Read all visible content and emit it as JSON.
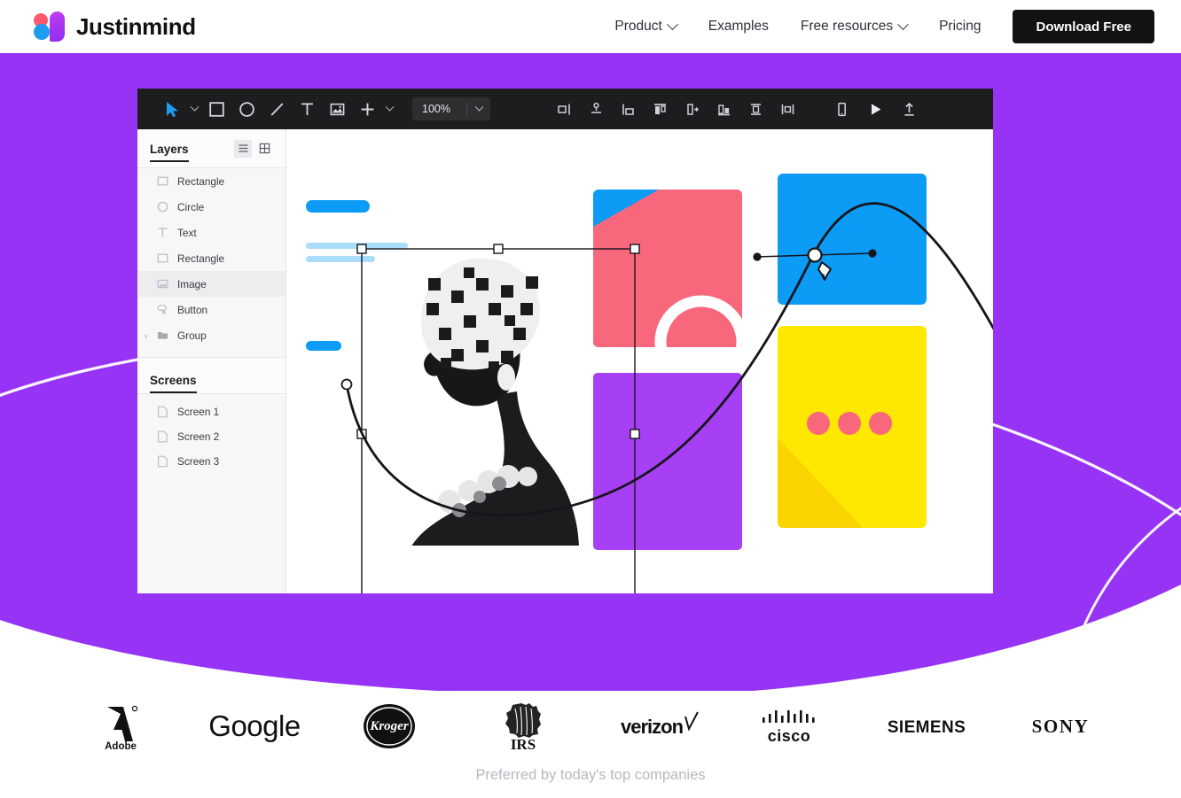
{
  "nav": {
    "brand": "Justinmind",
    "links": [
      {
        "label": "Product",
        "has_caret": true
      },
      {
        "label": "Examples",
        "has_caret": false
      },
      {
        "label": "Free resources",
        "has_caret": true
      },
      {
        "label": "Pricing",
        "has_caret": false
      }
    ],
    "cta_label": "Download Free"
  },
  "app": {
    "toolbar": {
      "zoom_value": "100%",
      "left_tools": [
        "cursor-icon",
        "chevron-down-icon",
        "rectangle-icon",
        "circle-icon",
        "line-icon",
        "text-icon",
        "image-icon",
        "plus-icon",
        "chevron-down-icon"
      ],
      "align_tools": [
        "align-left-icon",
        "align-center-horizontal-icon",
        "align-right-icon",
        "align-top-icon",
        "distribute-horizontal-icon",
        "align-bottom-icon",
        "align-middle-vertical-icon",
        "distribute-vertical-icon"
      ],
      "right_tools": [
        "device-phone-icon",
        "play-icon",
        "share-upload-icon"
      ]
    },
    "panel": {
      "layers_title": "Layers",
      "layers_view_list_icon": "list-view-icon",
      "layers_view_grid_icon": "grid-view-icon",
      "layers": [
        {
          "label": "Rectangle",
          "icon": "rectangle-icon",
          "selected": false,
          "group": false
        },
        {
          "label": "Circle",
          "icon": "circle-icon",
          "selected": false,
          "group": false
        },
        {
          "label": "Text",
          "icon": "text-icon",
          "selected": false,
          "group": false
        },
        {
          "label": "Rectangle",
          "icon": "rectangle-icon",
          "selected": false,
          "group": false
        },
        {
          "label": "Image",
          "icon": "image-icon",
          "selected": true,
          "group": false
        },
        {
          "label": "Button",
          "icon": "button-icon",
          "selected": false,
          "group": false
        },
        {
          "label": "Group",
          "icon": "folder-icon",
          "selected": false,
          "group": true
        }
      ],
      "screens_title": "Screens",
      "screens": [
        {
          "label": "Screen 1",
          "icon": "document-icon"
        },
        {
          "label": "Screen 2",
          "icon": "document-icon"
        },
        {
          "label": "Screen 3",
          "icon": "document-icon"
        }
      ]
    }
  },
  "logos": [
    {
      "name": "Adobe",
      "icon": "adobe-logo"
    },
    {
      "name": "Google",
      "icon": "google-logo"
    },
    {
      "name": "Kroger",
      "icon": "kroger-logo"
    },
    {
      "name": "IRS",
      "icon": "irs-logo"
    },
    {
      "name": "verizon",
      "icon": "verizon-logo"
    },
    {
      "name": "cisco",
      "icon": "cisco-logo"
    },
    {
      "name": "SIEMENS",
      "icon": "siemens-logo"
    },
    {
      "name": "SONY",
      "icon": "sony-logo"
    }
  ],
  "tagline": "Preferred by today's top companies",
  "colors": {
    "hero_purple": "#9633f5",
    "accent_blue": "#0c9bf5",
    "accent_pink": "#f9677c",
    "accent_yellow": "#ffe800",
    "accent_purple": "#a73ff5",
    "toolbar_dark": "#1d1d1f",
    "cta_black": "#121212"
  }
}
